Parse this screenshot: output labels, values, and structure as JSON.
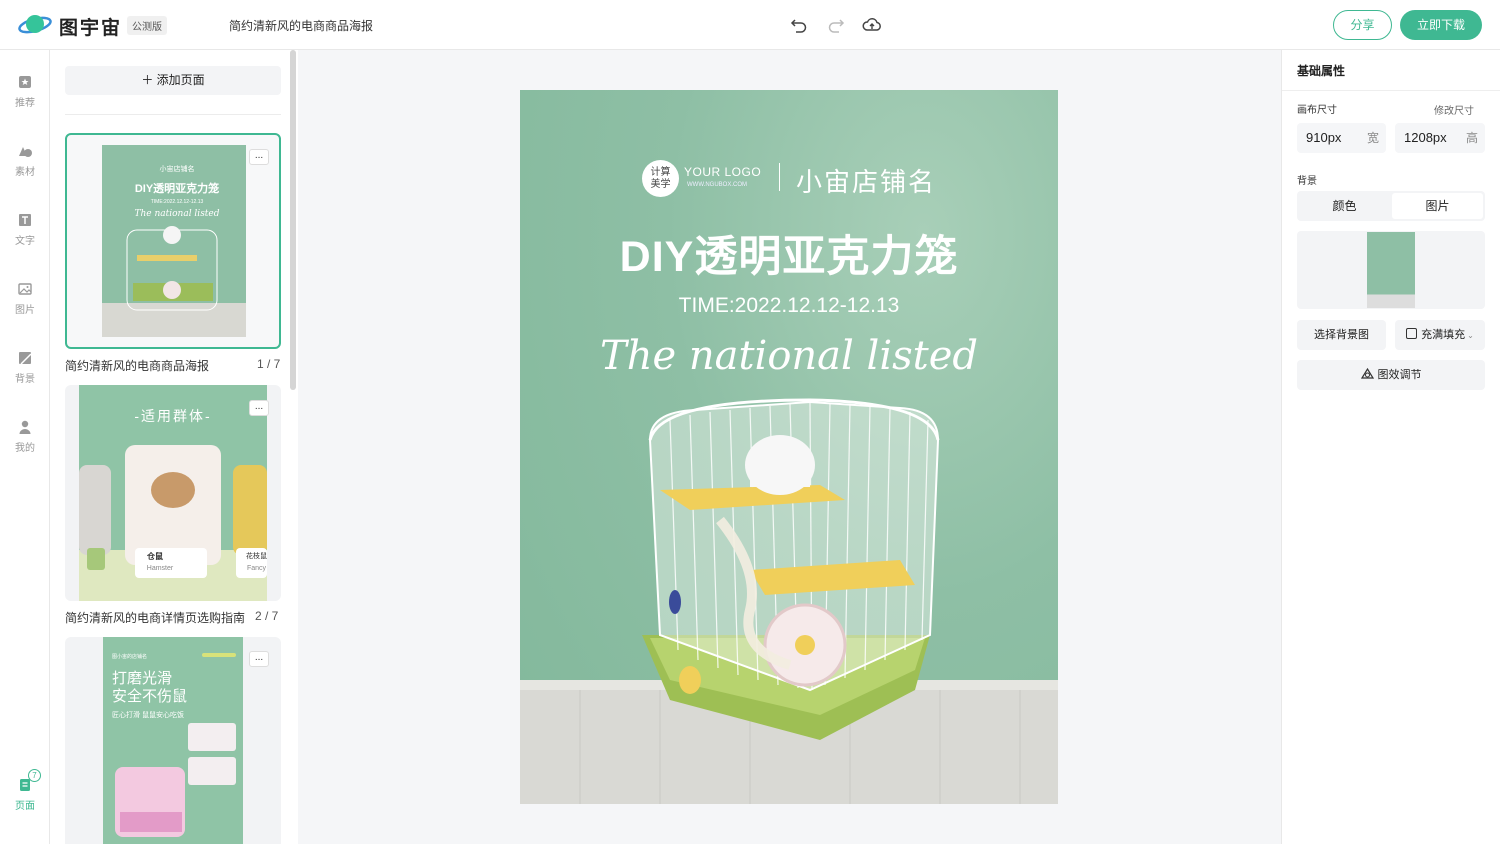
{
  "header": {
    "brand": "图宇宙",
    "beta_badge": "公测版",
    "doc_title": "简约清新风的电商商品海报",
    "share_label": "分享",
    "download_label": "立即下载"
  },
  "rail": {
    "items": [
      {
        "label": "推荐",
        "icon": "star-icon"
      },
      {
        "label": "素材",
        "icon": "shapes-icon"
      },
      {
        "label": "文字",
        "icon": "text-icon"
      },
      {
        "label": "图片",
        "icon": "image-icon"
      },
      {
        "label": "背景",
        "icon": "background-icon"
      },
      {
        "label": "我的",
        "icon": "user-icon"
      }
    ],
    "pages_label": "页面",
    "pages_count": "7"
  },
  "pages": {
    "add_label": "添加页面",
    "more": "...",
    "thumbs": [
      {
        "label": "简约清新风的电商商品海报",
        "count": "1 / 7"
      },
      {
        "label": "简约清新风的电商详情页选购指南",
        "count": "2 / 7"
      }
    ],
    "thumb1": {
      "shop": "小宙店铺名",
      "headline": "DIY透明亚克力笼",
      "time": "TIME:2022.12.12-12.13",
      "script": "The national listed"
    },
    "thumb2": {
      "title": "-适用群体-",
      "card_main": "仓鼠",
      "card_main_en": "Hamster",
      "card_side": "花枝鼠",
      "card_side_en": "Fancy"
    },
    "thumb3": {
      "shop": "图小宙的店铺名",
      "title1": "打磨光滑",
      "title2": "安全不伤鼠",
      "sub": "匠心打滑 鼠鼠安心吃饭"
    }
  },
  "poster": {
    "logo_text_1": "计算",
    "logo_text_2": "美学",
    "your_logo": "YOUR LOGO",
    "logo_url": "WWW.NGUBOX.COM",
    "shop_name": "小宙店铺名",
    "headline": "DIY透明亚克力笼",
    "time": "TIME:2022.12.12-12.13",
    "script": "The national listed",
    "bg_color": "#8ebfa5"
  },
  "props": {
    "title": "基础属性",
    "canvas_size_label": "画布尺寸",
    "edit_size_label": "修改尺寸",
    "width_value": "910px",
    "width_unit": "宽",
    "height_value": "1208px",
    "height_unit": "高",
    "background_label": "背景",
    "tab_color": "颜色",
    "tab_image": "图片",
    "choose_bg": "选择背景图",
    "fill_mode": "充满填充",
    "effect": "图效调节"
  },
  "colors": {
    "accent": "#3fb892",
    "poster_green": "#8ebfa5"
  }
}
